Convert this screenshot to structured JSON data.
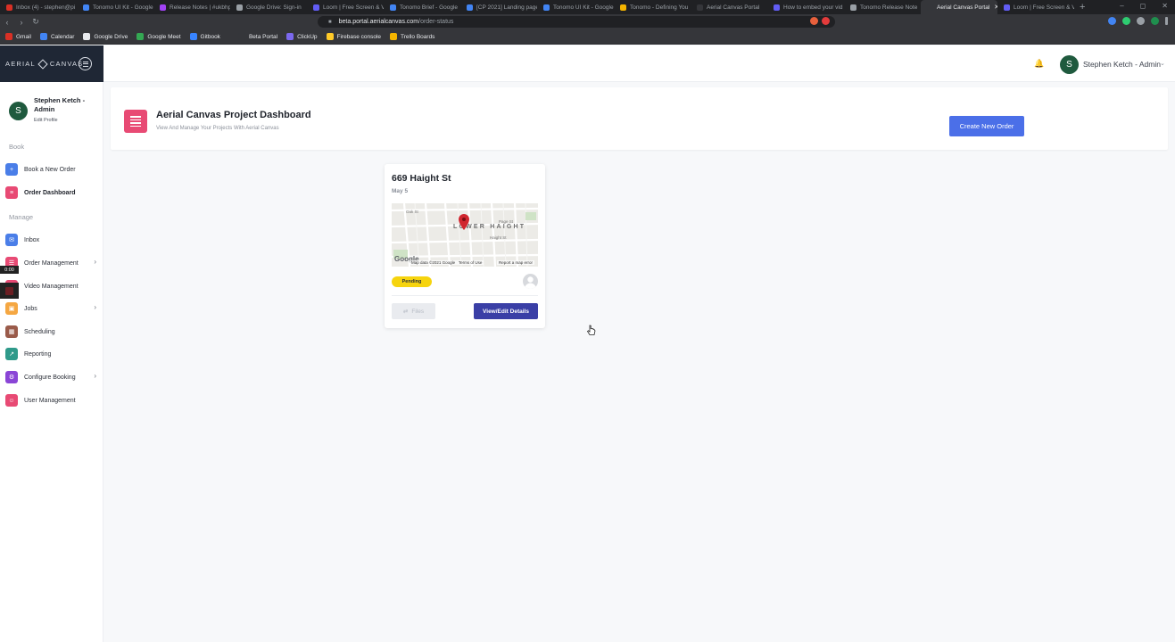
{
  "browser": {
    "tabs": [
      {
        "title": "Inbox (4) - stephen@pi",
        "color": "#d93025"
      },
      {
        "title": "Tonomo UI Kit - Google",
        "color": "#4285f4"
      },
      {
        "title": "Release Notes | #ukbhp2",
        "color": "#a142f4"
      },
      {
        "title": "Google Drive: Sign-in",
        "color": "#9aa0a6"
      },
      {
        "title": "Loom | Free Screen & V",
        "color": "#625df5"
      },
      {
        "title": "Tonomo Brief - Google",
        "color": "#4285f4"
      },
      {
        "title": "[CP 2021] Landing page",
        "color": "#4285f4"
      },
      {
        "title": "Tonomo UI Kit - Google",
        "color": "#4285f4"
      },
      {
        "title": "Tonomo - Defining You",
        "color": "#f4b400"
      },
      {
        "title": "Aerial Canvas Portal",
        "color": "#35363a"
      },
      {
        "title": "How to embed your vid",
        "color": "#625df5"
      },
      {
        "title": "Tonomo Release Note",
        "color": "#9aa0a6"
      },
      {
        "title": "Aerial Canvas Portal",
        "color": "#35363a",
        "active": true
      },
      {
        "title": "Loom | Free Screen & V",
        "color": "#625df5"
      }
    ],
    "new_tab": "+",
    "window_controls": [
      "–",
      "◻",
      "✕"
    ],
    "url_host": "beta.portal.aerialcanvas.com",
    "url_path": "/order-status",
    "bookmarks": [
      {
        "label": "Gmail",
        "color": "#d93025"
      },
      {
        "label": "Calendar",
        "color": "#4285f4"
      },
      {
        "label": "Google Drive",
        "color": "#e8eaed"
      },
      {
        "label": "Google Meet",
        "color": "#34a853"
      },
      {
        "label": "Gitbook",
        "color": "#3884ff"
      },
      {
        "label": "Beta Portal",
        "color": "#35363a"
      },
      {
        "label": "ClickUp",
        "color": "#7b68ee"
      },
      {
        "label": "Firebase console",
        "color": "#ffca28"
      },
      {
        "label": "Trello Boards",
        "color": "#f4b400"
      }
    ]
  },
  "app": {
    "brand_left": "AERIAL",
    "brand_right": "CANVAS",
    "header_user": "Stephen Ketch - Admin",
    "avatar_initial": "S",
    "sidebar": {
      "profile_name": "Stephen Ketch - Admin",
      "edit_profile": "Edit Profile",
      "section_book": "Book",
      "section_manage": "Manage",
      "timer": "0:00",
      "items": [
        {
          "label": "Book a New Order",
          "icon": "calendar-plus-icon",
          "color": "#4a7ee8"
        },
        {
          "label": "Order Dashboard",
          "icon": "dashboard-icon",
          "color": "#e84a74"
        },
        {
          "label": "Inbox",
          "icon": "mail-icon",
          "color": "#4a7ee8"
        },
        {
          "label": "Order Management",
          "icon": "orders-icon",
          "color": "#e84a74"
        },
        {
          "label": "Video Management",
          "icon": "video-icon",
          "color": "#e84a74"
        },
        {
          "label": "Jobs",
          "icon": "briefcase-icon",
          "color": "#f5a742"
        },
        {
          "label": "Scheduling",
          "icon": "schedule-icon",
          "color": "#9a5b4a"
        },
        {
          "label": "Reporting",
          "icon": "chart-icon",
          "color": "#2f9a8a"
        },
        {
          "label": "Configure Booking",
          "icon": "settings-icon",
          "color": "#8a45d6"
        },
        {
          "label": "User Management",
          "icon": "users-icon",
          "color": "#e84a74"
        }
      ]
    },
    "dashboard": {
      "title": "Aerial Canvas Project Dashboard",
      "subtitle": "View And Manage Your Projects With Aerial Canvas",
      "create_button": "Create New Order"
    },
    "order": {
      "address": "669 Haight St",
      "date": "May 5",
      "status": "Pending",
      "files_button": "Files",
      "view_button": "View/Edit Details",
      "map": {
        "area_label": "LOWER HAIGHT",
        "street_oak": "Oak St",
        "street_page": "Page St",
        "street_haight": "Haight St",
        "google": "Google",
        "map_data": "Map data ©2021 Google",
        "terms": "Terms of Use",
        "report": "Report a map error"
      }
    }
  }
}
